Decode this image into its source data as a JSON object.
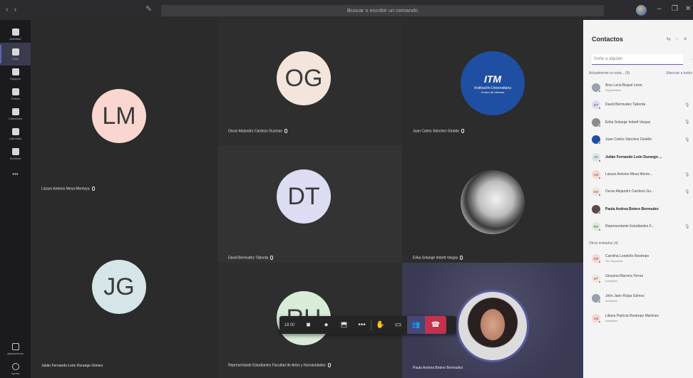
{
  "titlebar": {
    "back_glyph": "‹",
    "forward_glyph": "›",
    "search_placeholder": "Buscar o escribir un comando",
    "minimize": "–",
    "restore": "❐",
    "close": "✕"
  },
  "rail": {
    "items": [
      {
        "label": "Actividad",
        "icon": "bell-icon"
      },
      {
        "label": "Chat",
        "icon": "chat-icon"
      },
      {
        "label": "Equipos",
        "icon": "teams-icon"
      },
      {
        "label": "Tareas",
        "icon": "assignments-icon"
      },
      {
        "label": "Calendario",
        "icon": "calendar-icon"
      },
      {
        "label": "Llamadas",
        "icon": "phone-icon"
      },
      {
        "label": "Archivos",
        "icon": "files-icon"
      }
    ],
    "more": "•••",
    "apps_label": "Aplicaciones",
    "help_label": "Ayuda"
  },
  "tiles": [
    {
      "initials": "LM",
      "name": "Lázaro Antonio Mesa Montoya",
      "color": "#f9d6cf",
      "text_color": "#3b3b3b"
    },
    {
      "initials": "OG",
      "name": "Oscar Alejandro Cardozo Guzman",
      "color": "#f3e5dc",
      "text_color": "#3b3b3b"
    },
    {
      "initials": "",
      "name": "Juan Carlos Sánchez Giraldo",
      "logo_main": "ITM",
      "logo_line1": "Institución Universitaria",
      "logo_line2": "Centro de Idiomas",
      "color": "#1f4fa3"
    },
    {
      "initials": "DT",
      "name": "David Bermudez Taborda",
      "color": "#dcdcf2",
      "text_color": "#3b3b3b"
    },
    {
      "initials": "",
      "name": "Erika Solange Imbett Vargas",
      "color": "#e8e8e8"
    },
    {
      "initials": "JG",
      "name": "Julián Fernando León Durango Gómez",
      "color": "#d6e6e8",
      "text_color": "#3b3b3b"
    },
    {
      "initials": "RH",
      "name": "Representante Estudiantes Facultad de Artes y Humanidades",
      "color": "#d8ecd8",
      "text_color": "#3b3b3b"
    },
    {
      "initials": "",
      "name": "Paula Andrea Botero Bermudez",
      "color": "#3f3f5a"
    }
  ],
  "controls": {
    "timer": "18:00",
    "more": "•••"
  },
  "panel": {
    "title": "Contactos",
    "invite_placeholder": "Invite a alguien",
    "in_meeting_label": "Actualmente en esta...  (9)",
    "mute_all": "Silenciar a todos",
    "others_label": "Otros invitados  (4)",
    "in_meeting": [
      {
        "name": "Ana Lucía Begué Leiva",
        "sub": "Organizador",
        "initials": "",
        "color": "#9aa0b0",
        "bold": false,
        "mic": false
      },
      {
        "name": "David Bermudez Taborda",
        "sub": "",
        "initials": "DT",
        "color": "#dcdcf2",
        "bold": false,
        "mic": true
      },
      {
        "name": "Erika Solange Imbett Vargas",
        "sub": "",
        "initials": "",
        "color": "#8a8a8a",
        "bold": false,
        "mic": true
      },
      {
        "name": "Juan Carlos Sánchez Giraldo",
        "sub": "",
        "initials": "",
        "color": "#1f4fa3",
        "bold": false,
        "mic": true
      },
      {
        "name": "Julián Fernando León Durango ...",
        "sub": "",
        "initials": "JG",
        "color": "#d6e6e8",
        "bold": true,
        "mic": false
      },
      {
        "name": "Lázaro Antonio Mesa Monto...",
        "sub": "",
        "initials": "LM",
        "color": "#f9d6cf",
        "bold": false,
        "mic": true
      },
      {
        "name": "Oscar Alejandro Cardozo Gu...",
        "sub": "",
        "initials": "OG",
        "color": "#f3e5dc",
        "bold": false,
        "mic": true
      },
      {
        "name": "Paula Andrea Botero Bermudez",
        "sub": "",
        "initials": "",
        "color": "#5a4a48",
        "bold": true,
        "mic": false
      },
      {
        "name": "Representante Estudiantes F...",
        "sub": "",
        "initials": "RH",
        "color": "#d8ecd8",
        "bold": false,
        "mic": true
      }
    ],
    "others": [
      {
        "name": "Carolina Londoño Restrepo",
        "sub": "Sin respuesta",
        "initials": "CR",
        "color": "#f9d6cf"
      },
      {
        "name": "Giovanni Barrera Torres",
        "sub": "Aceptado",
        "initials": "GT",
        "color": "#f3e5dc"
      },
      {
        "name": "John Jairo Rojas Gómez",
        "sub": "Aceptado",
        "initials": "",
        "color": "#9aa0b0"
      },
      {
        "name": "Liliana Patricia Restrepo Martínez",
        "sub": "Aceptado",
        "initials": "LM",
        "color": "#f9d6cf"
      }
    ]
  }
}
